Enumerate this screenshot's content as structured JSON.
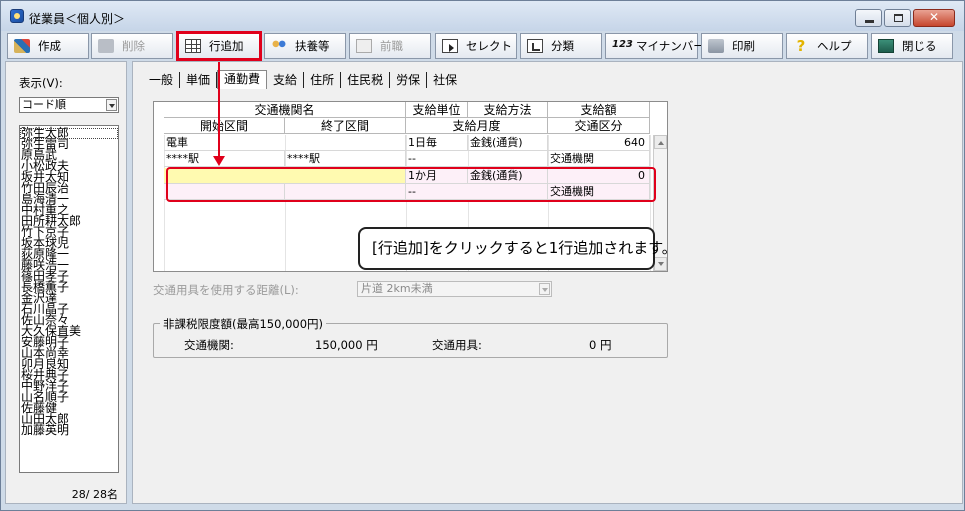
{
  "window": {
    "title": "従業員＜個人別＞"
  },
  "toolbar": {
    "create": "作成",
    "delete": "削除",
    "add_row": "行追加",
    "dependents": "扶養等",
    "prev_job": "前職",
    "select": "セレクト",
    "branch": "分類",
    "mynumber_icon": "123",
    "mynumber": "マイナンバー",
    "print": "印刷",
    "help": "ヘルプ",
    "close": "閉じる"
  },
  "left": {
    "display_label": "表示(V):",
    "sort_value": "コード順",
    "employees": [
      "弥生太郎",
      "弥生雷司",
      "原島武",
      "小松政夫",
      "坂井太知",
      "竹田辰治",
      "島海清一",
      "中村重之",
      "田所耕太郎",
      "竹下京子",
      "坂本球児",
      "荻原隆一",
      "藤咲浩一",
      "篠田孝子",
      "長橋薫子",
      "金沢達",
      "石川晶子",
      "佐山奈々",
      "大久保直美",
      "安藤明子",
      "山本尚幸",
      "卯月良知",
      "桜井典子",
      "中野洋子",
      "山名順子",
      "佐藤健",
      "山田太郎",
      "加藤英明"
    ],
    "count": "28/ 28名"
  },
  "tabs": [
    "一般",
    "単価",
    "通勤費",
    "支給",
    "住所",
    "住民税",
    "労保",
    "社保"
  ],
  "grid": {
    "header": {
      "route_name": "交通機関名",
      "pay_unit": "支給単位",
      "pay_method": "支給方法",
      "pay_amount": "支給額",
      "start_section": "開始区間",
      "end_section": "終了区間",
      "pay_month": "支給月度",
      "transport_class": "交通区分"
    },
    "rows": [
      {
        "name": "電車",
        "unit": "1日毎",
        "method": "金銭(通貨)",
        "amount": "640",
        "start": "****駅",
        "end": "****駅",
        "month": "--",
        "class": "交通機関"
      },
      {
        "name": "",
        "unit": "1か月",
        "method": "金銭(通貨)",
        "amount": "0",
        "start": "",
        "end": "",
        "month": "--",
        "class": "交通機関"
      }
    ]
  },
  "callout": "[行追加]をクリックすると1行追加されます。",
  "distance": {
    "label": "交通用具を使用する距離(L):",
    "value": "片道 2km未満"
  },
  "limit": {
    "title": "非課税限度額(最高150,000円)",
    "transit_label": "交通機関:",
    "transit_value": "150,000 円",
    "vehicle_label": "交通用具:",
    "vehicle_value": "0 円"
  },
  "colors": {
    "highlight_red": "#e0001b",
    "selected_row": "#fffab0",
    "new_row": "#fdf0f8"
  }
}
